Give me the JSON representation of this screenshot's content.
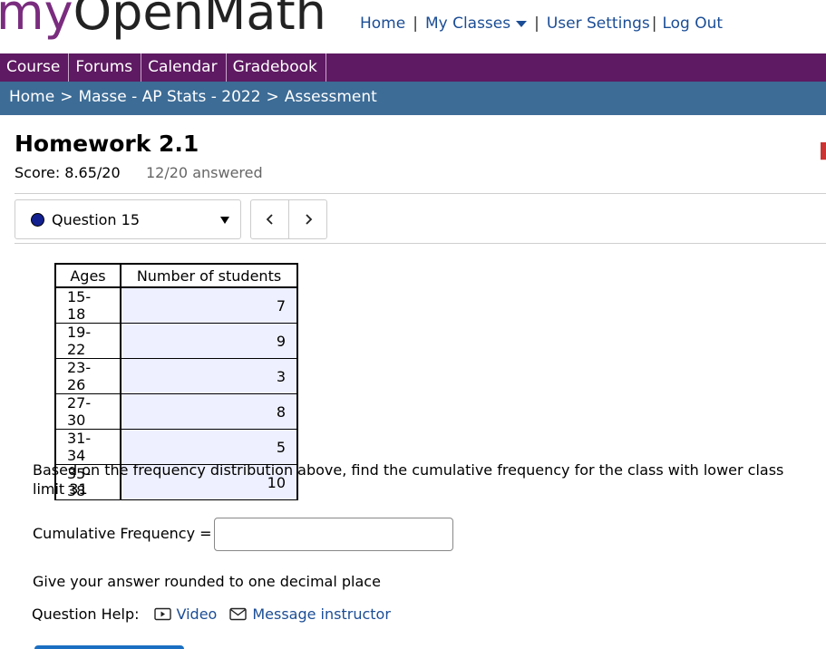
{
  "brand": {
    "my": "my",
    "rest": "OpenMath"
  },
  "topnav": {
    "home": "Home",
    "sep1": "|",
    "my_classes": "My Classes",
    "sep2": "|",
    "user_settings": "User Settings",
    "sep3": "|",
    "log_out": "Log Out"
  },
  "tabs": [
    "Course",
    "Forums",
    "Calendar",
    "Gradebook"
  ],
  "breadcrumb": {
    "home": "Home",
    "sep": ">",
    "course": "Masse - AP Stats - 2022",
    "current": "Assessment"
  },
  "assessment": {
    "title": "Homework 2.1",
    "score": "Score: 8.65/20",
    "answered": "12/20 answered",
    "question_label": "Question 15"
  },
  "table": {
    "headers": [
      "Ages",
      "Number of students"
    ],
    "rows": [
      [
        "15-18",
        "7"
      ],
      [
        "19-22",
        "9"
      ],
      [
        "23-26",
        "3"
      ],
      [
        "27-30",
        "8"
      ],
      [
        "31-34",
        "5"
      ],
      [
        "35-38",
        "10"
      ]
    ]
  },
  "question": {
    "prompt": "Based on the frequency distribution above, find the cumulative frequency for the class with lower class limit 31",
    "input_label": "Cumulative Frequency =",
    "input_value": "",
    "note": "Give your answer rounded to one decimal place"
  },
  "help": {
    "label": "Question Help:",
    "video": "Video",
    "message": "Message instructor"
  },
  "colors": {
    "purple_bar": "#5e1a62",
    "blue_bar": "#3d6c96",
    "link": "#1b4d95",
    "status_dot": "#13208f",
    "table_cell": "#eef0ff"
  }
}
